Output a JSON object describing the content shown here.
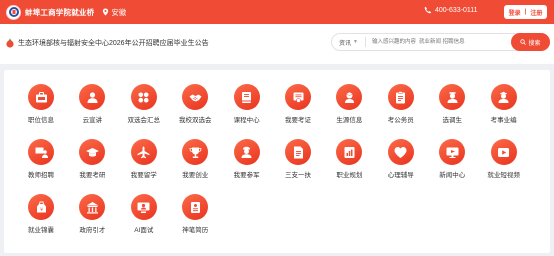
{
  "header": {
    "site_name": "蚌埠工商学院就业桥",
    "location": "安徽",
    "phone": "400-633-0111",
    "login": "登录",
    "divider": "|",
    "register": "注册"
  },
  "notice": {
    "text": "生态环境部核与辐射安全中心2026年公开招聘应届毕业生公告"
  },
  "search": {
    "category": "资讯",
    "placeholder": "输入感兴趣的内容  就业新闻 招聘信息",
    "button": "搜索"
  },
  "menu": [
    {
      "label": "职位信息",
      "icon": "job-icon"
    },
    {
      "label": "云宣讲",
      "icon": "person-icon"
    },
    {
      "label": "双选会汇总",
      "icon": "grid-icon"
    },
    {
      "label": "我校双选会",
      "icon": "handshake-icon"
    },
    {
      "label": "课程中心",
      "icon": "book-icon"
    },
    {
      "label": "我要考证",
      "icon": "certificate-icon"
    },
    {
      "label": "生源信息",
      "icon": "student-icon"
    },
    {
      "label": "考公务员",
      "icon": "clipboard-icon"
    },
    {
      "label": "选调生",
      "icon": "official-icon"
    },
    {
      "label": "考事业编",
      "icon": "officer-icon"
    },
    {
      "label": "教师招聘",
      "icon": "teacher-icon"
    },
    {
      "label": "我要考研",
      "icon": "graduation-cap-icon"
    },
    {
      "label": "我要留学",
      "icon": "plane-icon"
    },
    {
      "label": "我要创业",
      "icon": "trophy-icon"
    },
    {
      "label": "我要参军",
      "icon": "soldier-icon"
    },
    {
      "label": "三支一扶",
      "icon": "document-icon"
    },
    {
      "label": "职业规划",
      "icon": "report-icon"
    },
    {
      "label": "心理辅导",
      "icon": "heart-icon"
    },
    {
      "label": "新闻中心",
      "icon": "monitor-icon"
    },
    {
      "label": "就业短视频",
      "icon": "video-icon"
    },
    {
      "label": "就业锦囊",
      "icon": "bag-icon"
    },
    {
      "label": "政府引才",
      "icon": "government-icon"
    },
    {
      "label": "AI面试",
      "icon": "ai-interview-icon"
    },
    {
      "label": "神笔简历",
      "icon": "resume-icon"
    }
  ],
  "colors": {
    "brand": "#ef4b35",
    "icon_gradient_start": "#fb6b48",
    "icon_gradient_end": "#e9331f"
  }
}
